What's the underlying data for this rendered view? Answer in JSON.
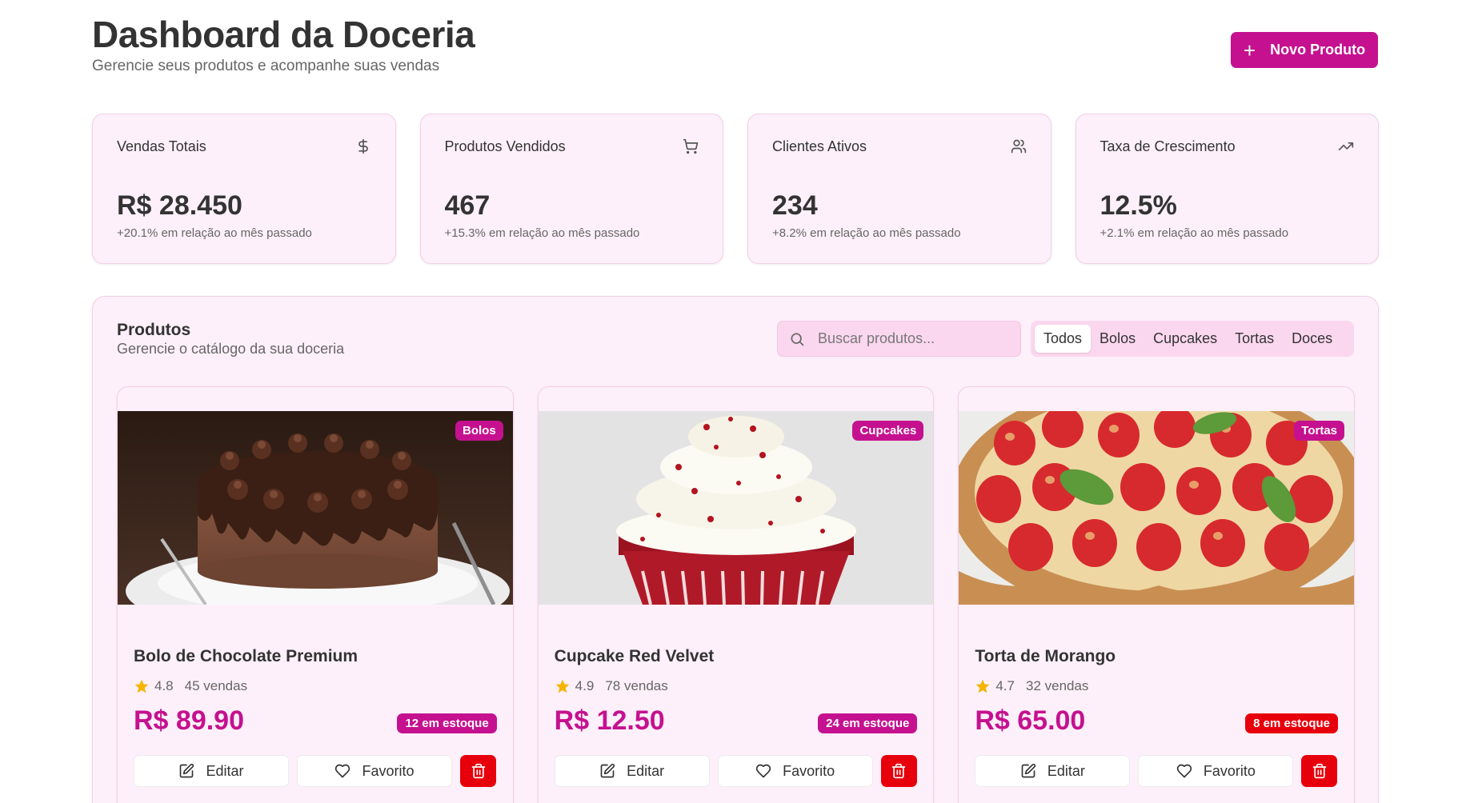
{
  "header": {
    "title": "Dashboard da Doceria",
    "subtitle": "Gerencie seus produtos e acompanhe suas vendas",
    "new_button_label": "Novo Produto"
  },
  "stats": [
    {
      "label": "Vendas Totais",
      "value": "R$ 28.450",
      "note": "+20.1% em relação ao mês passado",
      "icon": "dollar-icon"
    },
    {
      "label": "Produtos Vendidos",
      "value": "467",
      "note": "+15.3% em relação ao mês passado",
      "icon": "cart-icon"
    },
    {
      "label": "Clientes Ativos",
      "value": "234",
      "note": "+8.2% em relação ao mês passado",
      "icon": "users-icon"
    },
    {
      "label": "Taxa de Crescimento",
      "value": "12.5%",
      "note": "+2.1% em relação ao mês passado",
      "icon": "trending-up-icon"
    }
  ],
  "products_panel": {
    "title": "Produtos",
    "subtitle": "Gerencie o catálogo da sua doceria",
    "search_placeholder": "Buscar produtos...",
    "tabs": [
      "Todos",
      "Bolos",
      "Cupcakes",
      "Tortas",
      "Doces"
    ],
    "active_tab": "Todos"
  },
  "products": [
    {
      "name": "Bolo de Chocolate Premium",
      "category": "Bolos",
      "rating": "4.8",
      "sales": "45 vendas",
      "price": "R$ 89.90",
      "stock": "12 em estoque",
      "image": "chocolate-cake-photo"
    },
    {
      "name": "Cupcake Red Velvet",
      "category": "Cupcakes",
      "rating": "4.9",
      "sales": "78 vendas",
      "price": "R$ 12.50",
      "stock": "24 em estoque",
      "image": "red-velvet-cupcake-photo"
    },
    {
      "name": "Torta de Morango",
      "category": "Tortas",
      "rating": "4.7",
      "sales": "32 vendas",
      "price": "R$ 65.00",
      "stock": "8 em estoque",
      "image": "strawberry-tart-photo"
    }
  ],
  "card_actions": {
    "edit_label": "Editar",
    "favorite_label": "Favorito"
  },
  "colors": {
    "brand": "#c5118f",
    "danger": "#e7000b",
    "card_bg": "#fdf0fa",
    "star": "#f5b400"
  }
}
